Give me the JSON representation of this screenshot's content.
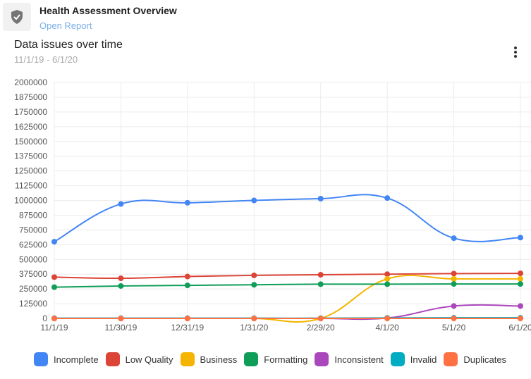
{
  "header": {
    "title": "Health Assessment Overview",
    "link": "Open Report",
    "icon": "shield-check-icon"
  },
  "card": {
    "title": "Data issues over time",
    "date_range": "11/1/19 - 6/1/20",
    "menu_icon": "more-vert-icon"
  },
  "chart_data": {
    "type": "line",
    "title": "Data issues over time",
    "categories": [
      "11/1/19",
      "11/30/19",
      "12/31/19",
      "1/31/20",
      "2/29/20",
      "4/1/20",
      "5/1/20",
      "6/1/20"
    ],
    "ylim": [
      0,
      2000000
    ],
    "yticks": [
      0,
      125000,
      250000,
      375000,
      500000,
      625000,
      750000,
      875000,
      1000000,
      1125000,
      1250000,
      1375000,
      1500000,
      1625000,
      1750000,
      1875000,
      2000000
    ],
    "grid": true,
    "legend": "bottom",
    "series": [
      {
        "name": "Incomplete",
        "color": "#4285f4",
        "values": [
          650000,
          970000,
          980000,
          1000000,
          1015000,
          1020000,
          680000,
          685000
        ]
      },
      {
        "name": "Low Quality",
        "color": "#db4437",
        "values": [
          350000,
          340000,
          355000,
          365000,
          370000,
          375000,
          380000,
          382000
        ]
      },
      {
        "name": "Business",
        "color": "#f4b400",
        "values": [
          0,
          0,
          0,
          0,
          0,
          335000,
          335000,
          335000
        ]
      },
      {
        "name": "Formatting",
        "color": "#0f9d58",
        "values": [
          265000,
          275000,
          280000,
          285000,
          290000,
          290000,
          292000,
          292000
        ]
      },
      {
        "name": "Inconsistent",
        "color": "#ab47bc",
        "values": [
          0,
          0,
          0,
          0,
          0,
          3000,
          105000,
          105000
        ]
      },
      {
        "name": "Invalid",
        "color": "#00acc1",
        "values": [
          2000,
          2000,
          2000,
          2000,
          2000,
          4000,
          5000,
          5000
        ]
      },
      {
        "name": "Duplicates",
        "color": "#ff7043",
        "values": [
          0,
          0,
          0,
          0,
          0,
          0,
          0,
          0
        ]
      }
    ]
  }
}
